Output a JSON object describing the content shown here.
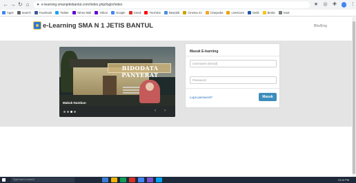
{
  "browser": {
    "url": "e-learning.smanjetisbantul.com/index.php/login/index",
    "bookmarks": [
      {
        "label": "Apps",
        "color": "#4285f4"
      },
      {
        "label": "Search",
        "color": "#5f6368"
      },
      {
        "label": "Facebook",
        "color": "#3b5998"
      },
      {
        "label": "Twitter",
        "color": "#1da1f2"
      },
      {
        "label": "Yahoo Mail",
        "color": "#6001d2"
      },
      {
        "label": "Yahoo",
        "color": "#6001d2"
      },
      {
        "label": "Google",
        "color": "#4285f4"
      },
      {
        "label": "Gmail",
        "color": "#d93025"
      },
      {
        "label": "YouTube",
        "color": "#ff0000"
      },
      {
        "label": "Beeplob",
        "color": "#4a90d9"
      },
      {
        "label": "Cinema 21",
        "color": "#c8a200"
      },
      {
        "label": "Cinepedia",
        "color": "#f5a623"
      },
      {
        "label": "LiveScore",
        "color": "#e8a400"
      },
      {
        "label": "Detik",
        "color": "#1e5aa8"
      },
      {
        "label": "Berita",
        "color": "#f5c518"
      },
      {
        "label": "Goal",
        "color": "#7a7a7a"
      }
    ]
  },
  "header": {
    "site_title": "e-Learning SMA N 1 JETIS BANTUL",
    "language_link": "Bhs/Eng"
  },
  "slider": {
    "banner_text": "BIDODATA PANYERAT",
    "slide_title": "Mabuk Numbun",
    "dot_count": 4,
    "active_dot": 3,
    "prev_arrow": "‹",
    "next_arrow": "›"
  },
  "login": {
    "title": "Masuk E-learning",
    "username_placeholder": "Username (Email)",
    "password_placeholder": "Password",
    "forgot_link": "Lupa password?",
    "submit_label": "Masuk"
  },
  "taskbar": {
    "search_placeholder": "Type here to search",
    "clock": "10:12 PM",
    "app_colors": [
      "#3a7bd5",
      "#f0b400",
      "#0f9d58",
      "#d93025",
      "#4285f4",
      "#7a4fd0",
      "#00a1f1"
    ]
  }
}
